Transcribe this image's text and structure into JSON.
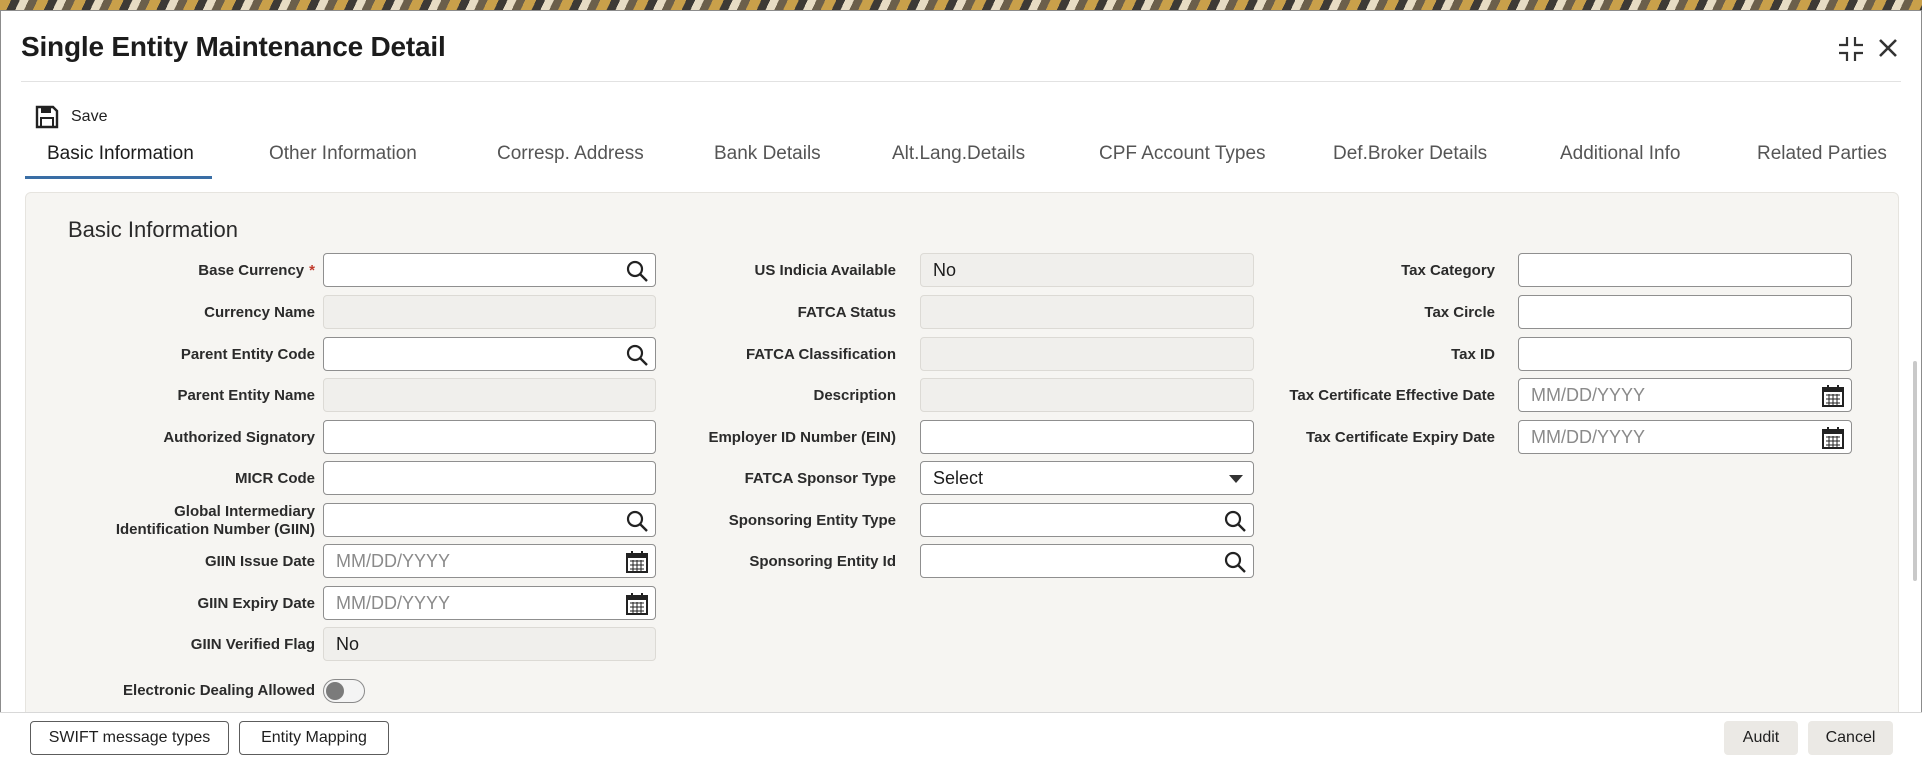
{
  "window": {
    "title": "Single Entity Maintenance Detail"
  },
  "toolbar": {
    "save_label": "Save"
  },
  "tabs": [
    {
      "label": "Basic Information",
      "active": true
    },
    {
      "label": "Other Information"
    },
    {
      "label": "Corresp. Address"
    },
    {
      "label": "Bank Details"
    },
    {
      "label": "Alt.Lang.Details"
    },
    {
      "label": "CPF Account Types"
    },
    {
      "label": "Def.Broker Details"
    },
    {
      "label": "Additional Info"
    },
    {
      "label": "Related Parties"
    }
  ],
  "section": {
    "title": "Basic Information"
  },
  "col1": {
    "base_currency": {
      "label": "Base Currency",
      "required": "*",
      "value": ""
    },
    "currency_name": {
      "label": "Currency Name",
      "value": ""
    },
    "parent_entity_code": {
      "label": "Parent Entity Code",
      "value": ""
    },
    "parent_entity_name": {
      "label": "Parent Entity Name",
      "value": ""
    },
    "authorized_signatory": {
      "label": "Authorized Signatory",
      "value": ""
    },
    "micr_code": {
      "label": "MICR Code",
      "value": ""
    },
    "giin": {
      "label_line1": "Global Intermediary",
      "label_line2": "Identification Number (GIIN)",
      "value": ""
    },
    "giin_issue_date": {
      "label": "GIIN Issue Date",
      "placeholder": "MM/DD/YYYY"
    },
    "giin_expiry_date": {
      "label": "GIIN Expiry Date",
      "placeholder": "MM/DD/YYYY"
    },
    "giin_verified_flag": {
      "label": "GIIN Verified Flag",
      "value": "No"
    },
    "electronic_dealing": {
      "label": "Electronic Dealing Allowed",
      "on": false
    }
  },
  "col2": {
    "us_indicia": {
      "label": "US Indicia Available",
      "value": "No"
    },
    "fatca_status": {
      "label": "FATCA Status",
      "value": ""
    },
    "fatca_classification": {
      "label": "FATCA Classification",
      "value": ""
    },
    "description": {
      "label": "Description",
      "value": ""
    },
    "employer_id": {
      "label": "Employer ID Number (EIN)",
      "value": ""
    },
    "fatca_sponsor_type": {
      "label": "FATCA Sponsor Type",
      "value": "Select"
    },
    "sponsoring_entity_type": {
      "label": "Sponsoring Entity Type",
      "value": ""
    },
    "sponsoring_entity_id": {
      "label": "Sponsoring Entity Id",
      "value": ""
    }
  },
  "col3": {
    "tax_category": {
      "label": "Tax Category",
      "value": ""
    },
    "tax_circle": {
      "label": "Tax Circle",
      "value": ""
    },
    "tax_id": {
      "label": "Tax ID",
      "value": ""
    },
    "tax_cert_effective": {
      "label": "Tax Certificate Effective Date",
      "placeholder": "MM/DD/YYYY"
    },
    "tax_cert_expiry": {
      "label": "Tax Certificate Expiry Date",
      "placeholder": "MM/DD/YYYY"
    }
  },
  "footer": {
    "swift_label": "SWIFT message types",
    "entity_mapping_label": "Entity Mapping",
    "audit_label": "Audit",
    "cancel_label": "Cancel"
  },
  "icons": {
    "search": "search-icon",
    "calendar": "calendar-icon",
    "save": "save-icon",
    "minimize": "minimize-icon",
    "close": "close-icon"
  }
}
